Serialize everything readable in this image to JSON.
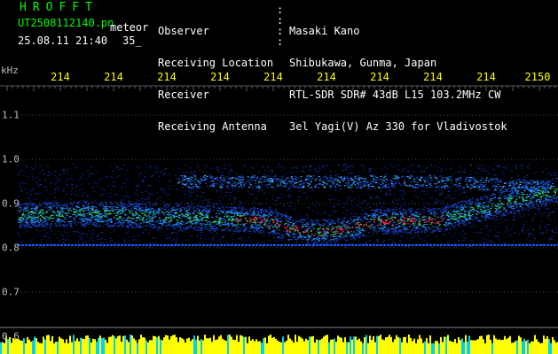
{
  "header": {
    "app_title": "HROFFT",
    "file_name": "UT2508112140.pn",
    "meteor_label": "meteor",
    "datetime": "25.08.11 21:40",
    "offset_value": "35_"
  },
  "info": {
    "labels": [
      "Observer",
      "Receiving Location",
      "Receiver",
      "Receiving Antenna"
    ],
    "values": [
      "Masaki Kano",
      "Shibukawa, Gunma, Japan",
      "RTL-SDR SDR# 43dB L15 103.2MHz CW",
      "3el Yagi(V) Az 330 for Vladivostok"
    ]
  },
  "axis": {
    "unit_label": "kHz",
    "freq_labels": [
      "214",
      "214",
      "214",
      "214",
      "214",
      "214",
      "214",
      "214",
      "214",
      "2150"
    ],
    "y_labels": [
      "1.1",
      "1.0",
      "0.9",
      "0.8",
      "0.7",
      "0.6"
    ]
  },
  "colors": {
    "background": "#000000",
    "header_green": "#00ff00",
    "header_text": "#ffffff",
    "freq_label": "#ffff00",
    "grid": "#5a5a5a",
    "bottom_bar": "#ffff00"
  }
}
